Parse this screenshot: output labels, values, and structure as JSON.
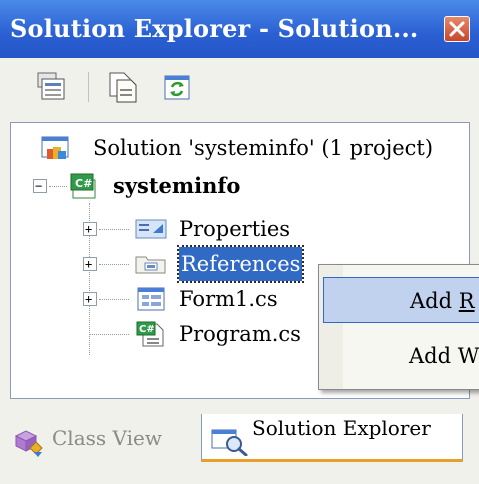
{
  "window": {
    "title": "Solution Explorer - Solution...",
    "close_icon": "close-x-icon"
  },
  "toolbar": {
    "buttons": [
      {
        "name": "properties-button",
        "icon": "properties-icon"
      },
      {
        "name": "show-all-files-button",
        "icon": "show-all-files-icon"
      },
      {
        "name": "refresh-button",
        "icon": "refresh-icon"
      }
    ]
  },
  "tree": {
    "solution": "Solution 'systeminfo' (1 project)",
    "project": "systeminfo",
    "items": [
      {
        "label": "Properties",
        "expander": "+"
      },
      {
        "label": "References",
        "expander": "+",
        "selected": true
      },
      {
        "label": "Form1.cs",
        "expander": "+"
      },
      {
        "label": "Program.cs"
      }
    ],
    "project_expander": "−"
  },
  "context_menu": {
    "items": [
      {
        "label": "Add R",
        "hovered": true
      },
      {
        "label": "Add W"
      }
    ]
  },
  "tabs": {
    "class_view": "Class View",
    "solution_explorer": "Solution Explorer",
    "active": "Solution Explorer"
  },
  "colors": {
    "titlebar": "#2a5fd2",
    "selection": "#316ac5",
    "menu_hover": "#c1d2ee",
    "tab_accent": "#e8a028"
  }
}
